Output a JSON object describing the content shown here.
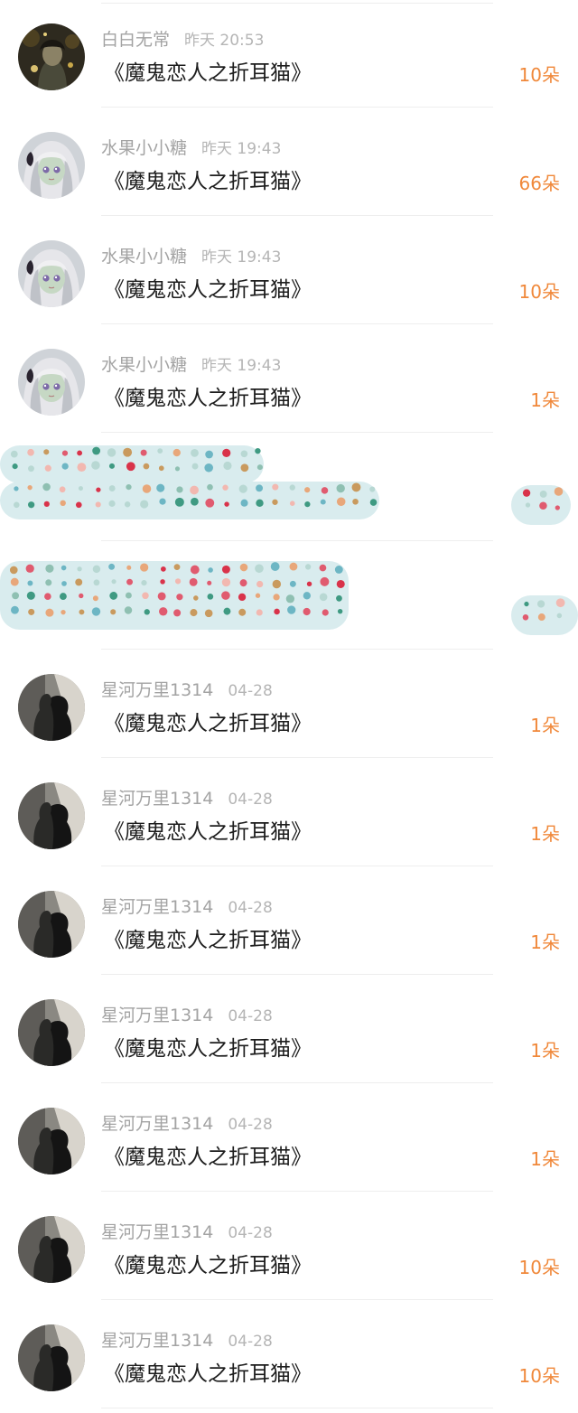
{
  "gift_records": [
    {
      "user": "白白无常",
      "time": "昨天 20:53",
      "gift": "《魔鬼恋人之折耳猫》",
      "count": "10朵",
      "avatar": "dark-portrait"
    },
    {
      "user": "水果小小糖",
      "time": "昨天 19:43",
      "gift": "《魔鬼恋人之折耳猫》",
      "count": "66朵",
      "avatar": "anime-girl"
    },
    {
      "user": "水果小小糖",
      "time": "昨天 19:43",
      "gift": "《魔鬼恋人之折耳猫》",
      "count": "10朵",
      "avatar": "anime-girl"
    },
    {
      "user": "水果小小糖",
      "time": "昨天 19:43",
      "gift": "《魔鬼恋人之折耳猫》",
      "count": "1朵",
      "avatar": "anime-girl"
    },
    {
      "censored": true
    },
    {
      "censored": true
    },
    {
      "user": "星河万里1314",
      "time": "04-28",
      "gift": "《魔鬼恋人之折耳猫》",
      "count": "1朵",
      "avatar": "silhouette-couple"
    },
    {
      "user": "星河万里1314",
      "time": "04-28",
      "gift": "《魔鬼恋人之折耳猫》",
      "count": "1朵",
      "avatar": "silhouette-couple"
    },
    {
      "user": "星河万里1314",
      "time": "04-28",
      "gift": "《魔鬼恋人之折耳猫》",
      "count": "1朵",
      "avatar": "silhouette-couple"
    },
    {
      "user": "星河万里1314",
      "time": "04-28",
      "gift": "《魔鬼恋人之折耳猫》",
      "count": "1朵",
      "avatar": "silhouette-couple"
    },
    {
      "user": "星河万里1314",
      "time": "04-28",
      "gift": "《魔鬼恋人之折耳猫》",
      "count": "1朵",
      "avatar": "silhouette-couple"
    },
    {
      "user": "星河万里1314",
      "time": "04-28",
      "gift": "《魔鬼恋人之折耳猫》",
      "count": "10朵",
      "avatar": "silhouette-couple"
    },
    {
      "user": "星河万里1314",
      "time": "04-28",
      "gift": "《魔鬼恋人之折耳猫》",
      "count": "10朵",
      "avatar": "silhouette-couple"
    }
  ],
  "colors": {
    "count_accent": "#f0883a",
    "censor_background": "#d9ecee",
    "censor_dots": [
      "#3f9a82",
      "#e05b6f",
      "#e8a77a",
      "#8fc0b2",
      "#d9334a",
      "#f2b8b0",
      "#6db6c4",
      "#c99a5e",
      "#b8d8d3"
    ]
  }
}
